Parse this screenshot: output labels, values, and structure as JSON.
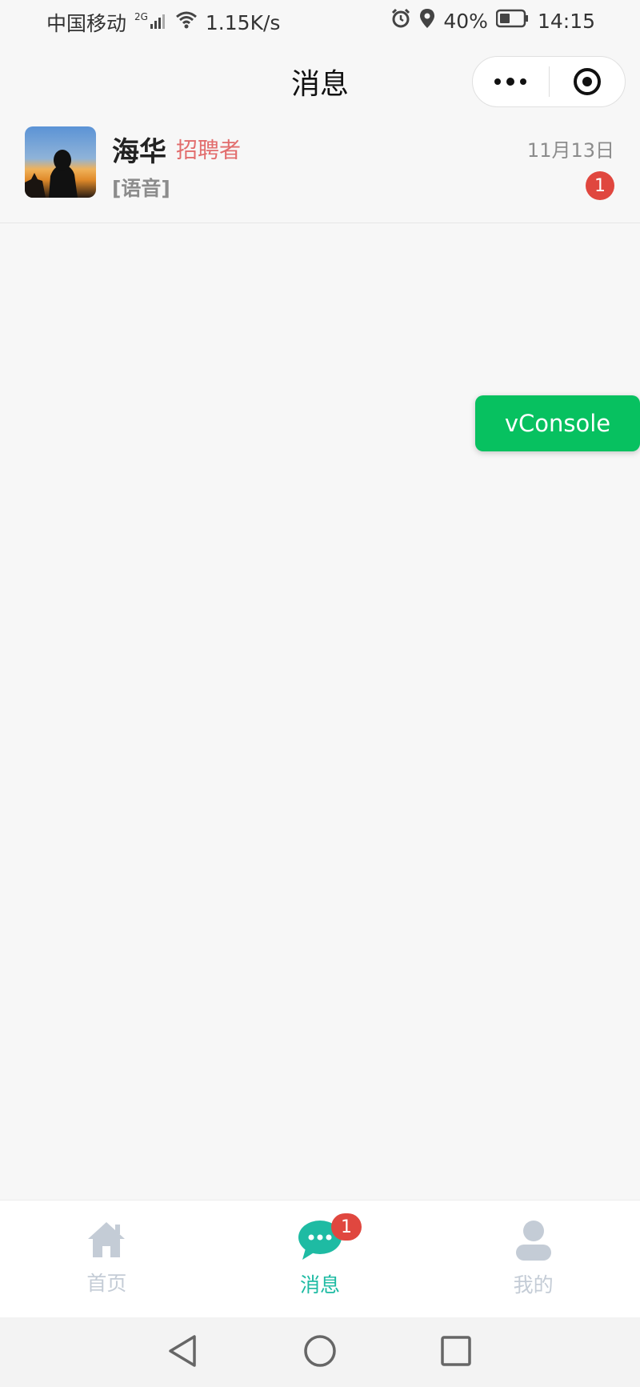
{
  "status_bar": {
    "carrier": "中国移动",
    "network": "2G",
    "speed": "1.15K/s",
    "battery": "40%",
    "time": "14:15"
  },
  "nav": {
    "title": "消息"
  },
  "conversations": [
    {
      "name": "海华",
      "role": "招聘者",
      "preview": "[语音]",
      "time": "11月13日",
      "unread": "1"
    }
  ],
  "vconsole": {
    "label": "vConsole",
    "color": "#07c160"
  },
  "tabbar": {
    "items": [
      {
        "label": "首页",
        "icon": "home-icon"
      },
      {
        "label": "消息",
        "icon": "chat-bubble-icon",
        "badge": "1",
        "active": true
      },
      {
        "label": "我的",
        "icon": "user-icon"
      }
    ],
    "active_color": "#1ebba3",
    "inactive_color": "#c4ccd6"
  },
  "system_nav": {
    "icons": [
      "back-triangle-icon",
      "home-circle-icon",
      "recent-square-icon"
    ]
  }
}
